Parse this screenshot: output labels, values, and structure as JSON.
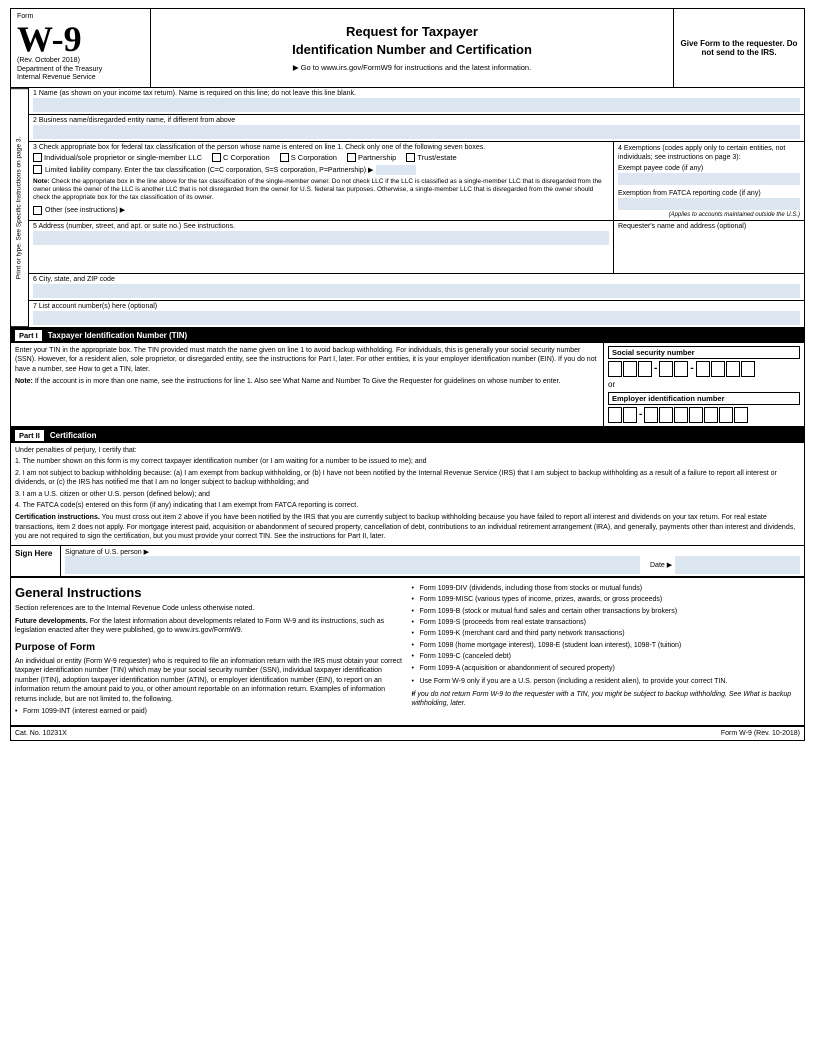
{
  "header": {
    "form_label": "Form",
    "form_name": "W-9",
    "rev_date": "(Rev. October 2018)",
    "dept": "Department of the Treasury",
    "irs": "Internal Revenue Service",
    "title_line1": "Request for Taxpayer",
    "title_line2": "Identification Number and Certification",
    "url_instruction": "▶ Go to www.irs.gov/FormW9 for instructions and the latest information.",
    "give_form": "Give Form to the requester. Do not send to the IRS."
  },
  "fields": {
    "line1_label": "1  Name (as shown on your income tax return). Name is required on this line; do not leave this line blank.",
    "line2_label": "2  Business name/disregarded entity name, if different from above",
    "line3_label": "3  Check appropriate box for federal tax classification of the person whose name is entered on line 1. Check only one of the following seven boxes.",
    "individual_label": "Individual/sole proprietor or single-member LLC",
    "c_corp_label": "C Corporation",
    "s_corp_label": "S Corporation",
    "partnership_label": "Partnership",
    "trust_label": "Trust/estate",
    "llc_label": "Limited liability company. Enter the tax classification (C=C corporation, S=S corporation, P=Partnership) ▶",
    "note_label": "Note:",
    "note_text": "Check the appropriate box in the line above for the tax classification of the single-member owner. Do not check LLC if the LLC is classified as a single-member LLC that is disregarded from the owner unless the owner of the LLC is another LLC that is not disregarded from the owner for U.S. federal tax purposes. Otherwise, a single-member LLC that is disregarded from the owner should check the appropriate box for the tax classification of its owner.",
    "other_label": "Other (see instructions) ▶",
    "line4_label": "4  Exemptions (codes apply only to certain entities, not individuals; see instructions on page 3):",
    "exempt_payee_label": "Exempt payee code (if any)",
    "fatca_label": "Exemption from FATCA reporting code (if any)",
    "applies_note": "(Applies to accounts maintained outside the U.S.)",
    "line5_label": "5  Address (number, street, and apt. or suite no.) See instructions.",
    "requester_label": "Requester's name and address (optional)",
    "line6_label": "6  City, state, and ZIP code",
    "line7_label": "7  List account number(s) here (optional)",
    "sidebar_text": "Print or type. See Specific Instructions on page 3."
  },
  "part1": {
    "roman": "Part I",
    "title": "Taxpayer Identification Number (TIN)",
    "instructions": "Enter your TIN in the appropriate box. The TIN provided must match the name given on line 1 to avoid backup withholding. For individuals, this is generally your social security number (SSN). However, for a resident alien, sole proprietor, or disregarded entity, see the instructions for Part I, later. For other entities, it is your employer identification number (EIN). If you do not have a number, see How to get a TIN, later.",
    "note": "Note:",
    "note_text": "If the account is in more than one name, see the instructions for line 1. Also see What Name and Number To Give the Requester for guidelines on whose number to enter.",
    "ssn_label": "Social security number",
    "or_text": "or",
    "ein_label": "Employer identification number"
  },
  "part2": {
    "roman": "Part II",
    "title": "Certification",
    "under_perjury": "Under penalties of perjury, I certify that:",
    "item1": "1. The number shown on this form is my correct taxpayer identification number (or I am waiting for a number to be issued to me); and",
    "item2": "2. I am not subject to backup withholding because: (a) I am exempt from backup withholding, or (b) I have not been notified by the Internal Revenue Service (IRS) that I am subject to backup withholding as a result of a failure to report all interest or dividends, or (c) the IRS has notified me that I am no longer subject to backup withholding; and",
    "item3": "3. I am a U.S. citizen or other U.S. person (defined below); and",
    "item4": "4. The FATCA code(s) entered on this form (if any) indicating that I am exempt from FATCA reporting is correct.",
    "cert_instructions_label": "Certification instructions.",
    "cert_instructions": "You must cross out item 2 above if you have been notified by the IRS that you are currently subject to backup withholding because you have failed to report all interest and dividends on your tax return. For real estate transactions, item 2 does not apply. For mortgage interest paid, acquisition or abandonment of secured property, cancellation of debt, contributions to an individual retirement arrangement (IRA), and generally, payments other than interest and dividends, you are not required to sign the certification, but you must provide your correct TIN. See the instructions for Part II, later."
  },
  "sign": {
    "sign_here": "Sign Here",
    "sig_label": "Signature of U.S. person ▶",
    "date_label": "Date ▶"
  },
  "general_instructions": {
    "title": "General Instructions",
    "intro": "Section references are to the Internal Revenue Code unless otherwise noted.",
    "future_label": "Future developments.",
    "future_text": "For the latest information about developments related to Form W-9 and its instructions, such as legislation enacted after they were published, go to www.irs.gov/FormW9.",
    "purpose_title": "Purpose of Form",
    "purpose_text": "An individual or entity (Form W-9 requester) who is required to file an information return with the IRS must obtain your correct taxpayer identification number (TIN) which may be your social security number (SSN), individual taxpayer identification number (ITIN), adoption taxpayer identification number (ATIN), or employer identification number (EIN), to report on an information return the amount paid to you, or other amount reportable on an information return. Examples of information returns include, but are not limited to, the following.",
    "bullet1": "Form 1099-INT (interest earned or paid)",
    "right_bullets": [
      "Form 1099-DIV (dividends, including those from stocks or mutual funds)",
      "Form 1099-MISC (various types of income, prizes, awards, or gross proceeds)",
      "Form 1099-B (stock or mutual fund sales and certain other transactions by brokers)",
      "Form 1099-S (proceeds from real estate transactions)",
      "Form 1099-K (merchant card and third party network transactions)",
      "Form 1098 (home mortgage interest), 1098-E (student loan interest), 1098-T (tuition)",
      "Form 1099-C (canceled debt)",
      "Form 1099-A (acquisition or abandonment of secured property)",
      "Use Form W-9 only if you are a U.S. person (including a resident alien), to provide your correct TIN.",
      "If you do not return Form W-9 to the requester with a TIN, you might be subject to backup withholding. See What is backup withholding, later."
    ]
  },
  "footer": {
    "cat_no": "Cat. No. 10231X",
    "form_name": "Form W-9 (Rev. 10-2018)"
  }
}
